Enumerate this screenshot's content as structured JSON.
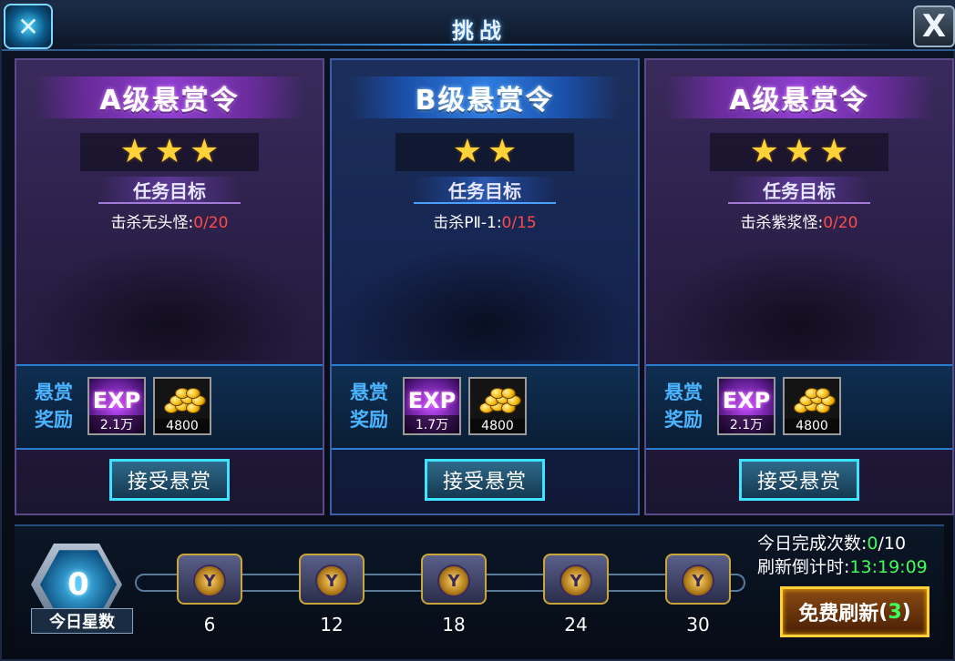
{
  "header": {
    "title": "挑战",
    "close_label": "X"
  },
  "cards": [
    {
      "rank": "A级悬赏令",
      "theme": "purple",
      "stars": 3,
      "objective_label": "任务目标",
      "task": "击杀无头怪:",
      "progress": "0/20",
      "reward_label_1": "悬赏",
      "reward_label_2": "奖励",
      "exp_label": "EXP",
      "exp_amount": "2.1万",
      "gold_amount": "4800",
      "accept_label": "接受悬赏"
    },
    {
      "rank": "B级悬赏令",
      "theme": "blue",
      "stars": 2,
      "objective_label": "任务目标",
      "task": "击杀PⅡ-1:",
      "progress": "0/15",
      "reward_label_1": "悬赏",
      "reward_label_2": "奖励",
      "exp_label": "EXP",
      "exp_amount": "1.7万",
      "gold_amount": "4800",
      "accept_label": "接受悬赏"
    },
    {
      "rank": "A级悬赏令",
      "theme": "purple",
      "stars": 3,
      "objective_label": "任务目标",
      "task": "击杀紫浆怪:",
      "progress": "0/20",
      "reward_label_1": "悬赏",
      "reward_label_2": "奖励",
      "exp_label": "EXP",
      "exp_amount": "2.1万",
      "gold_amount": "4800",
      "accept_label": "接受悬赏"
    }
  ],
  "bottom": {
    "today_stars_value": "0",
    "today_stars_label": "今日星数",
    "chest_thresholds": [
      "6",
      "12",
      "18",
      "24",
      "30"
    ],
    "completed_label": "今日完成次数:",
    "completed_value": "0",
    "completed_total": "/10",
    "refresh_timer_label": "刷新倒计时:",
    "refresh_timer_value": "13:19:09",
    "free_refresh_label": "免费刷新",
    "free_refresh_count": "3"
  },
  "colors": {
    "progress_red": "#ff4a4a",
    "timer_green": "#3dff5a",
    "accent_blue": "#4ab4ff",
    "gold": "#ffd23a"
  }
}
